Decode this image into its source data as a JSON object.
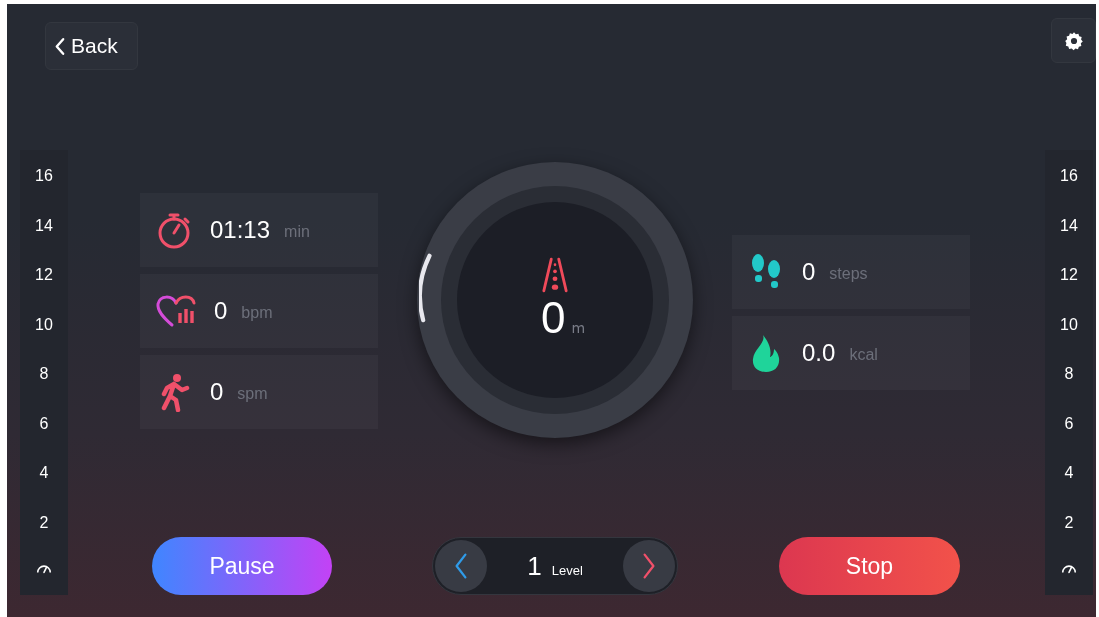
{
  "header": {
    "back_label": "Back"
  },
  "left_scale": {
    "ticks": [
      "16",
      "14",
      "12",
      "10",
      "8",
      "6",
      "4",
      "2"
    ]
  },
  "right_scale": {
    "ticks": [
      "16",
      "14",
      "12",
      "10",
      "8",
      "6",
      "4",
      "2"
    ]
  },
  "left_stats": [
    {
      "kind": "time",
      "value": "01:13",
      "unit": "min"
    },
    {
      "kind": "heart",
      "value": "0",
      "unit": "bpm"
    },
    {
      "kind": "runner",
      "value": "0",
      "unit": "spm"
    }
  ],
  "distance": {
    "value": "0",
    "unit": "m"
  },
  "right_stats": [
    {
      "kind": "steps",
      "value": "0",
      "unit": "steps"
    },
    {
      "kind": "calories",
      "value": "0.0",
      "unit": "kcal"
    }
  ],
  "controls": {
    "pause_label": "Pause",
    "level_value": "1",
    "level_label": "Level",
    "stop_label": "Stop"
  }
}
